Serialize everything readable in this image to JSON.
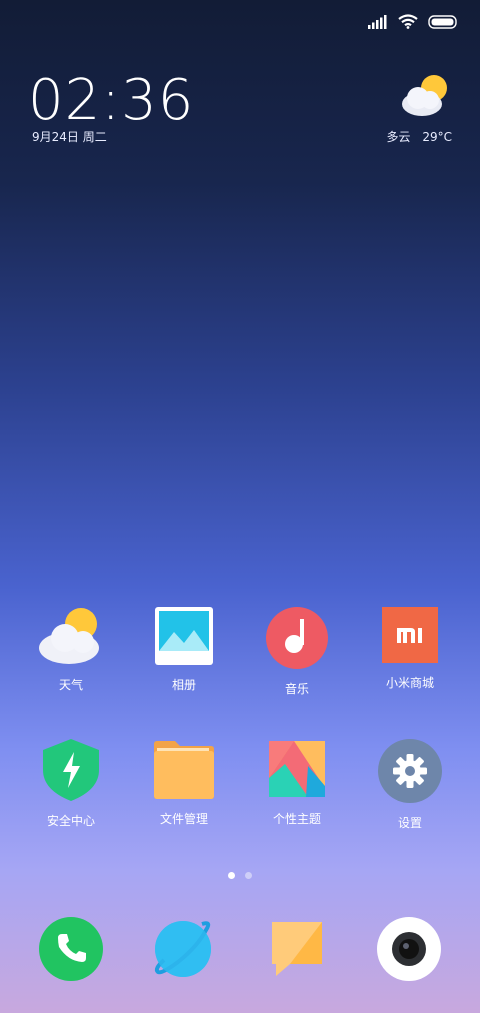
{
  "status": {
    "icons": [
      "signal-icon",
      "wifi-icon",
      "battery-icon"
    ]
  },
  "clock": {
    "time": "02:36",
    "date": "9月24日 周二"
  },
  "weather": {
    "condition": "多云",
    "temperature": "29°C",
    "icon": "partly-cloudy-icon"
  },
  "apps_row1": [
    {
      "label": "天气",
      "icon": "weather-app-icon"
    },
    {
      "label": "相册",
      "icon": "gallery-icon"
    },
    {
      "label": "音乐",
      "icon": "music-icon"
    },
    {
      "label": "小米商城",
      "icon": "mi-store-icon"
    }
  ],
  "apps_row2": [
    {
      "label": "安全中心",
      "icon": "security-shield-icon"
    },
    {
      "label": "文件管理",
      "icon": "folder-icon"
    },
    {
      "label": "个性主题",
      "icon": "themes-icon"
    },
    {
      "label": "设置",
      "icon": "gear-icon"
    }
  ],
  "page_indicator": {
    "count": 2,
    "active": 0
  },
  "dock": [
    {
      "name": "phone",
      "icon": "phone-icon"
    },
    {
      "name": "browser",
      "icon": "browser-icon"
    },
    {
      "name": "messages",
      "icon": "message-icon"
    },
    {
      "name": "camera",
      "icon": "camera-icon"
    }
  ],
  "colors": {
    "phone": "#21c461",
    "browser": "#2ab7f0",
    "messages": "#ffbd55",
    "music": "#ee5a63",
    "mi_store": "#f06845",
    "security": "#22c77b",
    "folder": "#ffb84f",
    "settings": "#6e86aa"
  }
}
